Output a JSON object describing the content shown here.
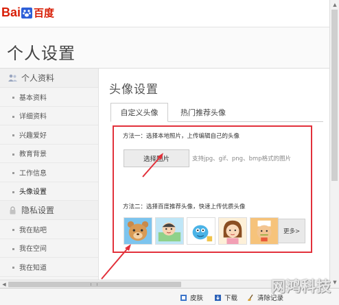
{
  "brand": {
    "logo_text_en": "Bai",
    "logo_text_cn": "百度",
    "brand_color": "#d81e06"
  },
  "header": {
    "title": "个人设置"
  },
  "sidebar": {
    "groups": [
      {
        "label": "个人资料",
        "icon": "user-group-icon",
        "items": [
          {
            "label": "基本资料"
          },
          {
            "label": "详细资料"
          },
          {
            "label": "兴趣爱好"
          },
          {
            "label": "教育背景"
          },
          {
            "label": "工作信息"
          },
          {
            "label": "头像设置",
            "active": true
          }
        ]
      },
      {
        "label": "隐私设置",
        "icon": "lock-icon",
        "items": [
          {
            "label": "我在贴吧"
          },
          {
            "label": "我在空间"
          },
          {
            "label": "我在知道"
          }
        ]
      }
    ]
  },
  "main": {
    "section_title": "头像设置",
    "tabs": [
      {
        "label": "自定义头像",
        "active": true
      },
      {
        "label": "热门推荐头像",
        "active": false
      }
    ],
    "method1": {
      "text": "方法一：选择本地照片，上传编辑自己的头像",
      "button_label": "选择图片",
      "hint": "支持jpg、gif、png、bmp格式的图片"
    },
    "method2": {
      "text": "方法二：选择百度推荐头像，快速上传优质头像",
      "more_label": "更多>"
    },
    "avatars": [
      {
        "name": "bear-avatar"
      },
      {
        "name": "boy-avatar"
      },
      {
        "name": "creature-avatar"
      },
      {
        "name": "girl-avatar"
      },
      {
        "name": "cook-avatar"
      }
    ],
    "highlight_color": "#e2303a"
  },
  "statusbar": {
    "items": [
      {
        "label": "皮肤",
        "icon": "skin-icon"
      },
      {
        "label": "下载",
        "icon": "download-icon"
      },
      {
        "label": "清除记录",
        "icon": "broom-icon"
      }
    ]
  },
  "watermark": "网鸿科技"
}
